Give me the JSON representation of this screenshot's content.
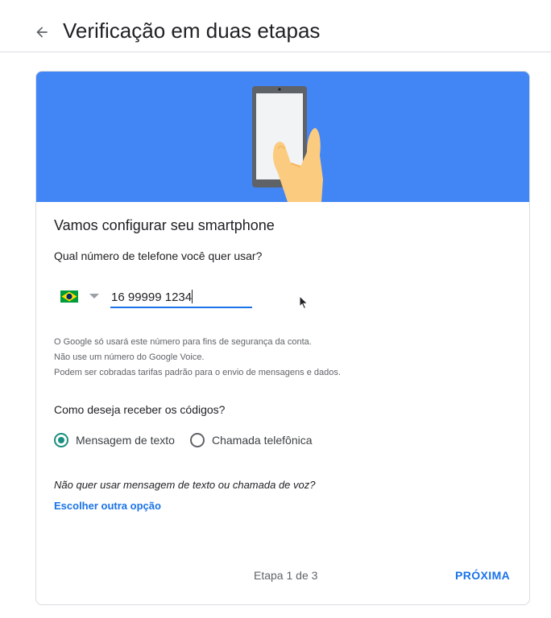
{
  "header": {
    "back_icon": "arrow-back-icon",
    "title": "Verificação em duas etapas"
  },
  "hero": {
    "background_color": "#4285f4",
    "illustration": "hand-holding-smartphone"
  },
  "setup": {
    "title": "Vamos configurar seu smartphone",
    "phone_question": "Qual número de telefone você quer usar?",
    "country_flag": "brazil-flag-icon",
    "phone_value": "16 99999 1234",
    "disclaimer": [
      "O Google só usará este número para fins de segurança da conta.",
      "Não use um número do Google Voice.",
      "Podem ser cobradas tarifas padrão para o envio de mensagens e dados."
    ]
  },
  "delivery": {
    "question": "Como deseja receber os códigos?",
    "options": [
      {
        "label": "Mensagem de texto",
        "selected": true
      },
      {
        "label": "Chamada telefônica",
        "selected": false
      }
    ],
    "accent_color": "#1a8f80"
  },
  "alternative": {
    "question": "Não quer usar mensagem de texto ou chamada de voz?",
    "link": "Escolher outra opção"
  },
  "footer": {
    "step": "Etapa 1 de 3",
    "next_label": "PRÓXIMA"
  }
}
